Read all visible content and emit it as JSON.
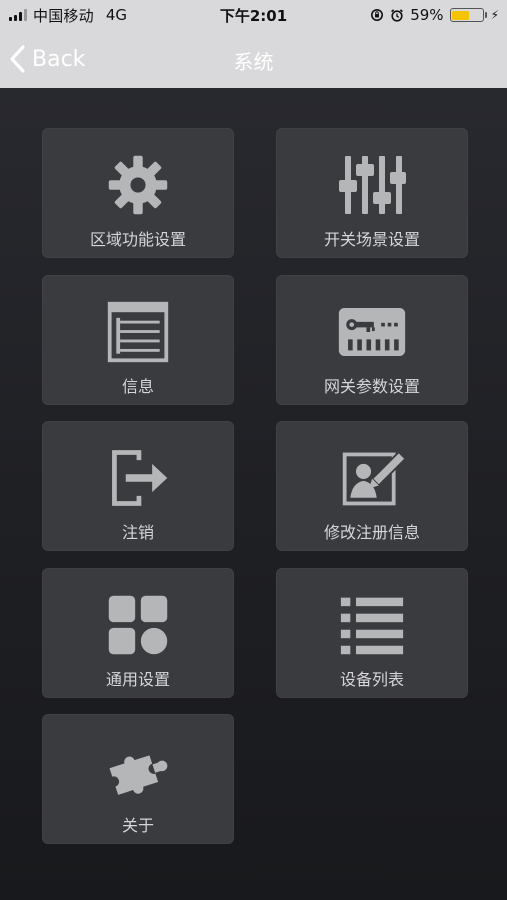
{
  "status_bar": {
    "carrier": "中国移动",
    "network": "4G",
    "time": "下午2:01",
    "battery_percent_text": "59%",
    "battery_level": 0.59,
    "battery_color": "#f5c400"
  },
  "nav": {
    "back_label": "Back",
    "title": "系统"
  },
  "tiles": [
    {
      "label": "区域功能设置",
      "icon": "gear-icon"
    },
    {
      "label": "开关场景设置",
      "icon": "sliders-icon"
    },
    {
      "label": "信息",
      "icon": "list-panel-icon"
    },
    {
      "label": "网关参数设置",
      "icon": "gateway-key-icon"
    },
    {
      "label": "注销",
      "icon": "logout-icon"
    },
    {
      "label": "修改注册信息",
      "icon": "edit-profile-icon"
    },
    {
      "label": "通用设置",
      "icon": "grid-shapes-icon"
    },
    {
      "label": "设备列表",
      "icon": "bullet-list-icon"
    },
    {
      "label": "关于",
      "icon": "puzzle-icon"
    }
  ],
  "colors": {
    "icon_gray": "#b5b6b8",
    "tile_bg": "#3a3b3f"
  }
}
